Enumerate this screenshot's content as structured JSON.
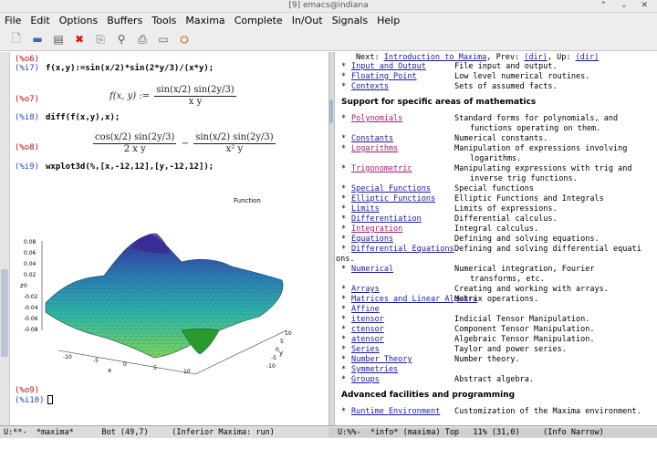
{
  "window": {
    "title": "[9] emacs@indiana",
    "controls": "⌃ ⌄ ✕"
  },
  "menu": [
    "File",
    "Edit",
    "Options",
    "Buffers",
    "Tools",
    "Maxima",
    "Complete",
    "In/Out",
    "Signals",
    "Help"
  ],
  "toolbar": [
    {
      "name": "new-file-icon",
      "glyph": "🗋"
    },
    {
      "name": "open-folder-icon",
      "glyph": "▬"
    },
    {
      "name": "save-icon",
      "glyph": "▤"
    },
    {
      "name": "close-x-icon",
      "glyph": "✖"
    },
    {
      "name": "copy-icon",
      "glyph": "⎘"
    },
    {
      "name": "search-icon",
      "glyph": "⚲"
    },
    {
      "name": "print-icon",
      "glyph": "⎙"
    },
    {
      "name": "preferences-icon",
      "glyph": "▭"
    },
    {
      "name": "help-icon",
      "glyph": "⛭"
    }
  ],
  "session": {
    "lines": [
      {
        "label": "(%o6)",
        "kind": "out",
        "top": 3
      },
      {
        "label": "(%i7)",
        "kind": "in",
        "top": 13,
        "input": "f(x,y):=sin(x/2)*sin(2*y/3)/(x*y);"
      },
      {
        "label": "(%o7)",
        "kind": "out",
        "top": 47
      },
      {
        "label": "(%i8)",
        "kind": "in",
        "top": 67,
        "input": "diff(f(x,y),x);"
      },
      {
        "label": "(%o8)",
        "kind": "out",
        "top": 100
      },
      {
        "label": "(%i9)",
        "kind": "in",
        "top": 121,
        "input": "wxplot3d(%,[x,-12,12],[y,-12,12]);"
      },
      {
        "label": "(%o9)",
        "kind": "out",
        "top": 366
      },
      {
        "label": "(%i10)",
        "kind": "in",
        "top": 377,
        "input": ""
      }
    ],
    "o7": {
      "lhs": "f(x, y) :=",
      "num": "sin(x/2) sin(2y/3)",
      "den": "x y"
    },
    "o8": {
      "num1": "cos(x/2) sin(2y/3)",
      "den1": "2 x y",
      "minus": "−",
      "num2": "sin(x/2) sin(2y/3)",
      "den2": "x² y"
    }
  },
  "plot": {
    "title": "Function",
    "zlabel": "z",
    "xlabel": "x",
    "ylabel": "y",
    "zticks": [
      "0.08",
      "0.06",
      "0.04",
      "0.02",
      "0",
      "-0.02",
      "-0.04",
      "-0.06",
      "-0.08"
    ],
    "xticks": [
      "-10",
      "-5",
      "0",
      "5",
      "10"
    ],
    "yticks": [
      "10",
      "5",
      "0",
      "-5",
      "-10"
    ]
  },
  "info": {
    "next": "Next:",
    "next_link": "Introduction to Maxima",
    "prev": "Prev:",
    "prev_link": "(dir)",
    "up": "Up:",
    "up_link": "(dir)",
    "top_entries": [
      {
        "name": "Input and Output",
        "desc": "File input and output."
      },
      {
        "name": "Floating Point",
        "desc": "Low level numerical routines."
      },
      {
        "name": "Contexts",
        "desc": "Sets of assumed facts."
      }
    ],
    "section1": "Support for specific areas of mathematics",
    "math_entries": [
      {
        "name": "Polynomials",
        "desc": "Standard forms for polynomials, and",
        "cont": "functions operating on them.",
        "visited": true
      },
      {
        "name": "Constants",
        "desc": "Numerical constants."
      },
      {
        "name": "Logarithms",
        "desc": "Manipulation of expressions involving",
        "cont": "logarithms.",
        "visited": true
      },
      {
        "name": "Trigonometric",
        "desc": "Manipulating expressions with trig and",
        "cont": "inverse trig functions.",
        "visited": true
      },
      {
        "name": "Special Functions",
        "desc": "Special functions"
      },
      {
        "name": "Elliptic Functions",
        "desc": "Elliptic Functions and Integrals"
      },
      {
        "name": "Limits",
        "desc": "Limits of expressions."
      },
      {
        "name": "Differentiation",
        "desc": "Differential calculus."
      },
      {
        "name": "Integration",
        "desc": "Integral calculus.",
        "visited": true
      },
      {
        "name": "Equations",
        "desc": "Defining and solving equations."
      },
      {
        "name": "Differential Equations",
        "desc": "Defining and solving differential equati",
        "wrap": "ons."
      },
      {
        "name": "Numerical",
        "desc": "Numerical integration, Fourier",
        "cont": "transforms, etc."
      },
      {
        "name": "Arrays",
        "desc": "Creating and working with arrays."
      },
      {
        "name": "Matrices and Linear Algebra",
        "desc": "Matrix operations."
      },
      {
        "name": "Affine",
        "desc": ""
      },
      {
        "name": "itensor",
        "desc": "Indicial Tensor Manipulation."
      },
      {
        "name": "ctensor",
        "desc": "Component Tensor Manipulation."
      },
      {
        "name": "atensor",
        "desc": "Algebraic Tensor Manipulation."
      },
      {
        "name": "Series",
        "desc": "Taylor and power series."
      },
      {
        "name": "Number Theory",
        "desc": "Number theory."
      },
      {
        "name": "Symmetries",
        "desc": ""
      },
      {
        "name": "Groups",
        "desc": "Abstract algebra."
      }
    ],
    "section2": "Advanced facilities and programming",
    "adv_entries": [
      {
        "name": "Runtime Environment",
        "desc": "Customization of the Maxima environment."
      }
    ]
  },
  "modeline": {
    "left": "U:**-  *maxima*      Bot (49,7)     (Inferior Maxima: run)",
    "right": "U:%%-  *info* (maxima) Top   11% (31,0)     (Info Narrow)"
  }
}
